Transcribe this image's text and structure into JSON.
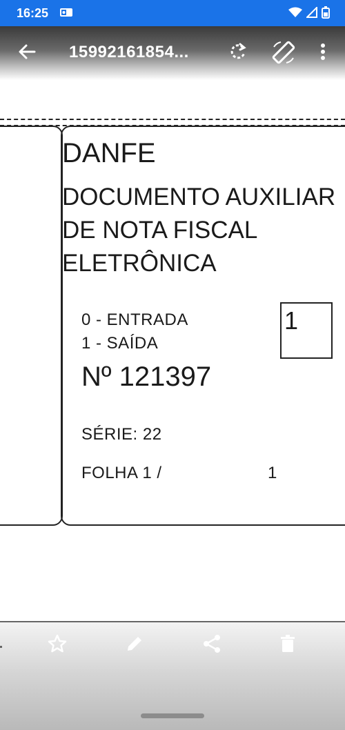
{
  "status_bar": {
    "time": "16:25"
  },
  "app_bar": {
    "title": "15992161854..."
  },
  "document": {
    "heading": "DANFE",
    "description_lines": [
      "DOCUMENTO AUXILIAR",
      "DE NOTA FISCAL",
      "ELETRÔNICA"
    ],
    "entrada_label": "0 - ENTRADA",
    "saida_label": "1 - SAÍDA",
    "type_value": "1",
    "numero": "Nº 121397",
    "serie": "SÉRIE: 22",
    "folha_label": "FOLHA 1 /",
    "folha_total": "1"
  },
  "bottom_bar": {
    "actions": [
      "star-icon",
      "edit-icon",
      "share-icon",
      "delete-icon"
    ]
  },
  "colors": {
    "status_bar": "#1a73e8",
    "app_bar_dark": "#3a3a3a",
    "icon_light": "#ffffff"
  }
}
